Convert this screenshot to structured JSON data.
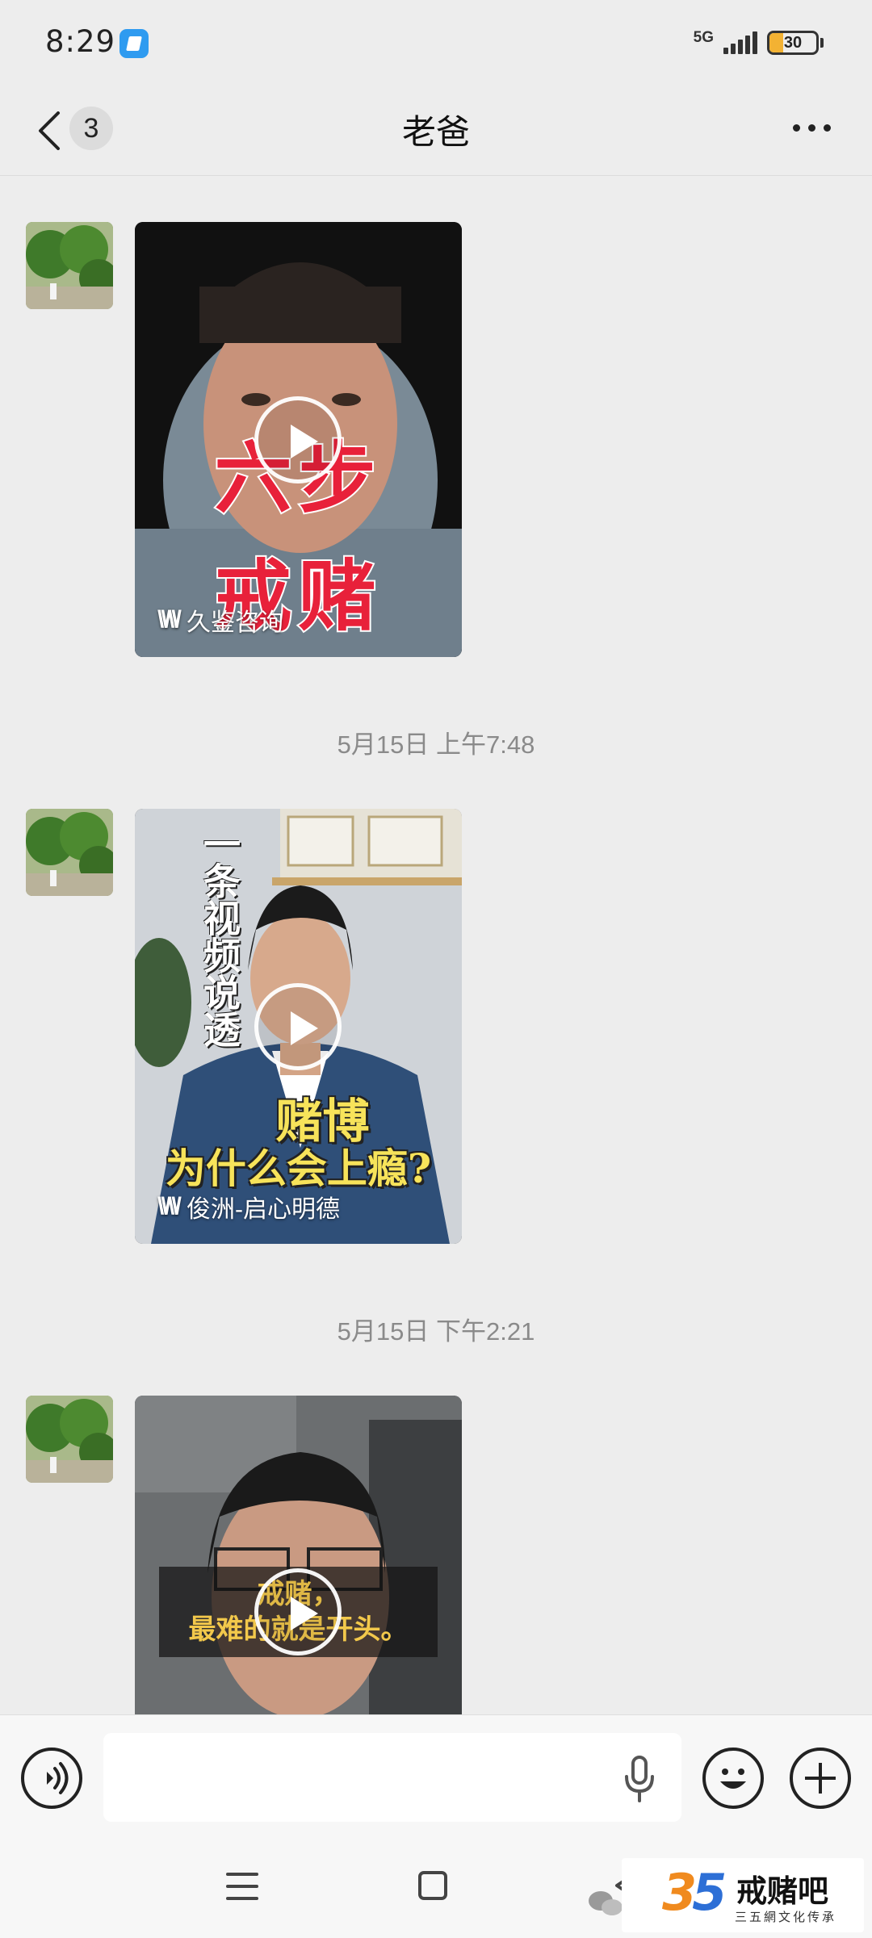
{
  "status_bar": {
    "time": "8:29",
    "network": "5G",
    "battery": "30",
    "battery_level": 0.3,
    "app_icon": "notification-app-icon"
  },
  "header": {
    "unread_count": "3",
    "title": "老爸",
    "back_icon": "chevron-left-icon",
    "more_icon": "more-dots-icon"
  },
  "messages": [
    {
      "type": "video",
      "overlay_lines": [
        "六步",
        "戒赌"
      ],
      "source": "久鉴咨询"
    },
    {
      "type": "video",
      "timestamp": "5月15日 上午7:48",
      "vertical_text": "一条视频说透",
      "overlay_lines": [
        "赌博",
        "为什么会上瘾?"
      ],
      "source": "俊洲-启心明德"
    },
    {
      "type": "video",
      "timestamp": "5月15日 下午2:21",
      "caption_lines": [
        "戒赌，",
        "最难的就是开头。"
      ]
    }
  ],
  "input_bar": {
    "voice_icon": "voice-mode-icon",
    "mic_icon": "microphone-icon",
    "emoji_icon": "emoji-icon",
    "plus_icon": "plus-icon"
  },
  "nav_bar": {
    "menu_icon": "menu-icon",
    "home_icon": "home-square-icon",
    "back_icon": "back-triangle-icon"
  },
  "watermark": {
    "number_left": "3",
    "number_right": "5",
    "name": "戒赌吧",
    "subtitle": "三五網文化传承"
  },
  "colors": {
    "background": "#ededed",
    "accent_red": "#e8213a",
    "caption_yellow": "#f7e35a",
    "battery": "#f3b233"
  }
}
